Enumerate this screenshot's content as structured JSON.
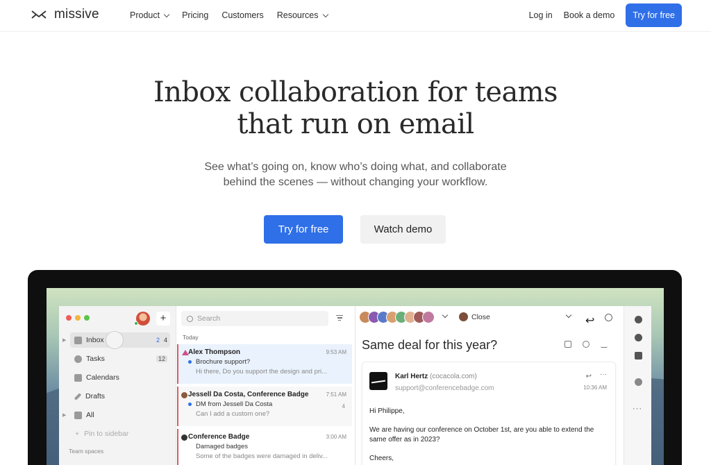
{
  "nav": {
    "logo_text": "missive",
    "links": [
      "Product",
      "Pricing",
      "Customers",
      "Resources"
    ],
    "login": "Log in",
    "book_demo": "Book a demo",
    "try_free": "Try for free"
  },
  "hero": {
    "title_line1": "Inbox collaboration for teams",
    "title_line2": "that run on email",
    "sub_line1": "See what’s going on, know who’s doing what, and collaborate",
    "sub_line2": "behind the scenes — without changing your workflow.",
    "cta_primary": "Try for free",
    "cta_secondary": "Watch demo"
  },
  "app": {
    "sidebar": {
      "items": [
        {
          "label": "Inbox",
          "badge_blue": "2",
          "badge_gray": "4"
        },
        {
          "label": "Tasks",
          "badge_gray": "12"
        },
        {
          "label": "Calendars"
        },
        {
          "label": "Drafts"
        },
        {
          "label": "All"
        },
        {
          "label": "Pin to sidebar"
        }
      ],
      "team_spaces": "Team spaces"
    },
    "list": {
      "search_placeholder": "Search",
      "section": "Today",
      "messages": [
        {
          "from": "Alex Thompson",
          "time": "9:53 AM",
          "subject": "Brochure support?",
          "preview": "Hi there, Do you support the design and pri..."
        },
        {
          "from": "Jessell Da Costa, Conference Badge",
          "time": "7:51 AM",
          "subject": "DM from Jessell Da Costa",
          "preview": "Can I add a custom one?",
          "count": "4"
        },
        {
          "from": "Conference Badge",
          "time": "3:00 AM",
          "subject": "Damaged badges",
          "preview": "Some of the badges were damaged in deliv..."
        }
      ]
    },
    "reader": {
      "close_label": "Close",
      "title": "Same deal for this year?",
      "sender_name": "Karl Hertz",
      "sender_domain": "(cocacola.com)",
      "sender_address": "support@conferencebadge.com",
      "time": "10:36 AM",
      "greeting": "Hi Philippe,",
      "body_line1": "We are having our conference on October 1st, are you able to extend the",
      "body_line2": "same offer as in 2023?",
      "signoff": "Cheers,"
    }
  },
  "colors": {
    "brand_blue": "#2f6fe8",
    "unread_red": "#e05a5a"
  }
}
